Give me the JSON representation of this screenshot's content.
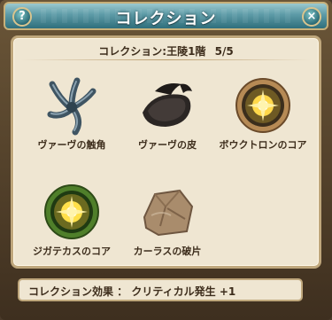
{
  "window": {
    "title": "コレクション",
    "help_label": "?",
    "close_label": "×"
  },
  "collection": {
    "heading": "コレクション:王陵1階",
    "count": "5/5",
    "items": [
      {
        "label": "ヴァーヴの触角",
        "icon": "tentacle-icon"
      },
      {
        "label": "ヴァーヴの皮",
        "icon": "hide-icon"
      },
      {
        "label": "ボウクトロンのコア",
        "icon": "core-orb-gold-icon"
      },
      {
        "label": "ジガテカスのコア",
        "icon": "core-orb-green-icon"
      },
      {
        "label": "カーラスの破片",
        "icon": "rock-shard-icon"
      }
    ]
  },
  "effect": {
    "text": "コレクション効果 ： クリティカル発生 +1"
  }
}
